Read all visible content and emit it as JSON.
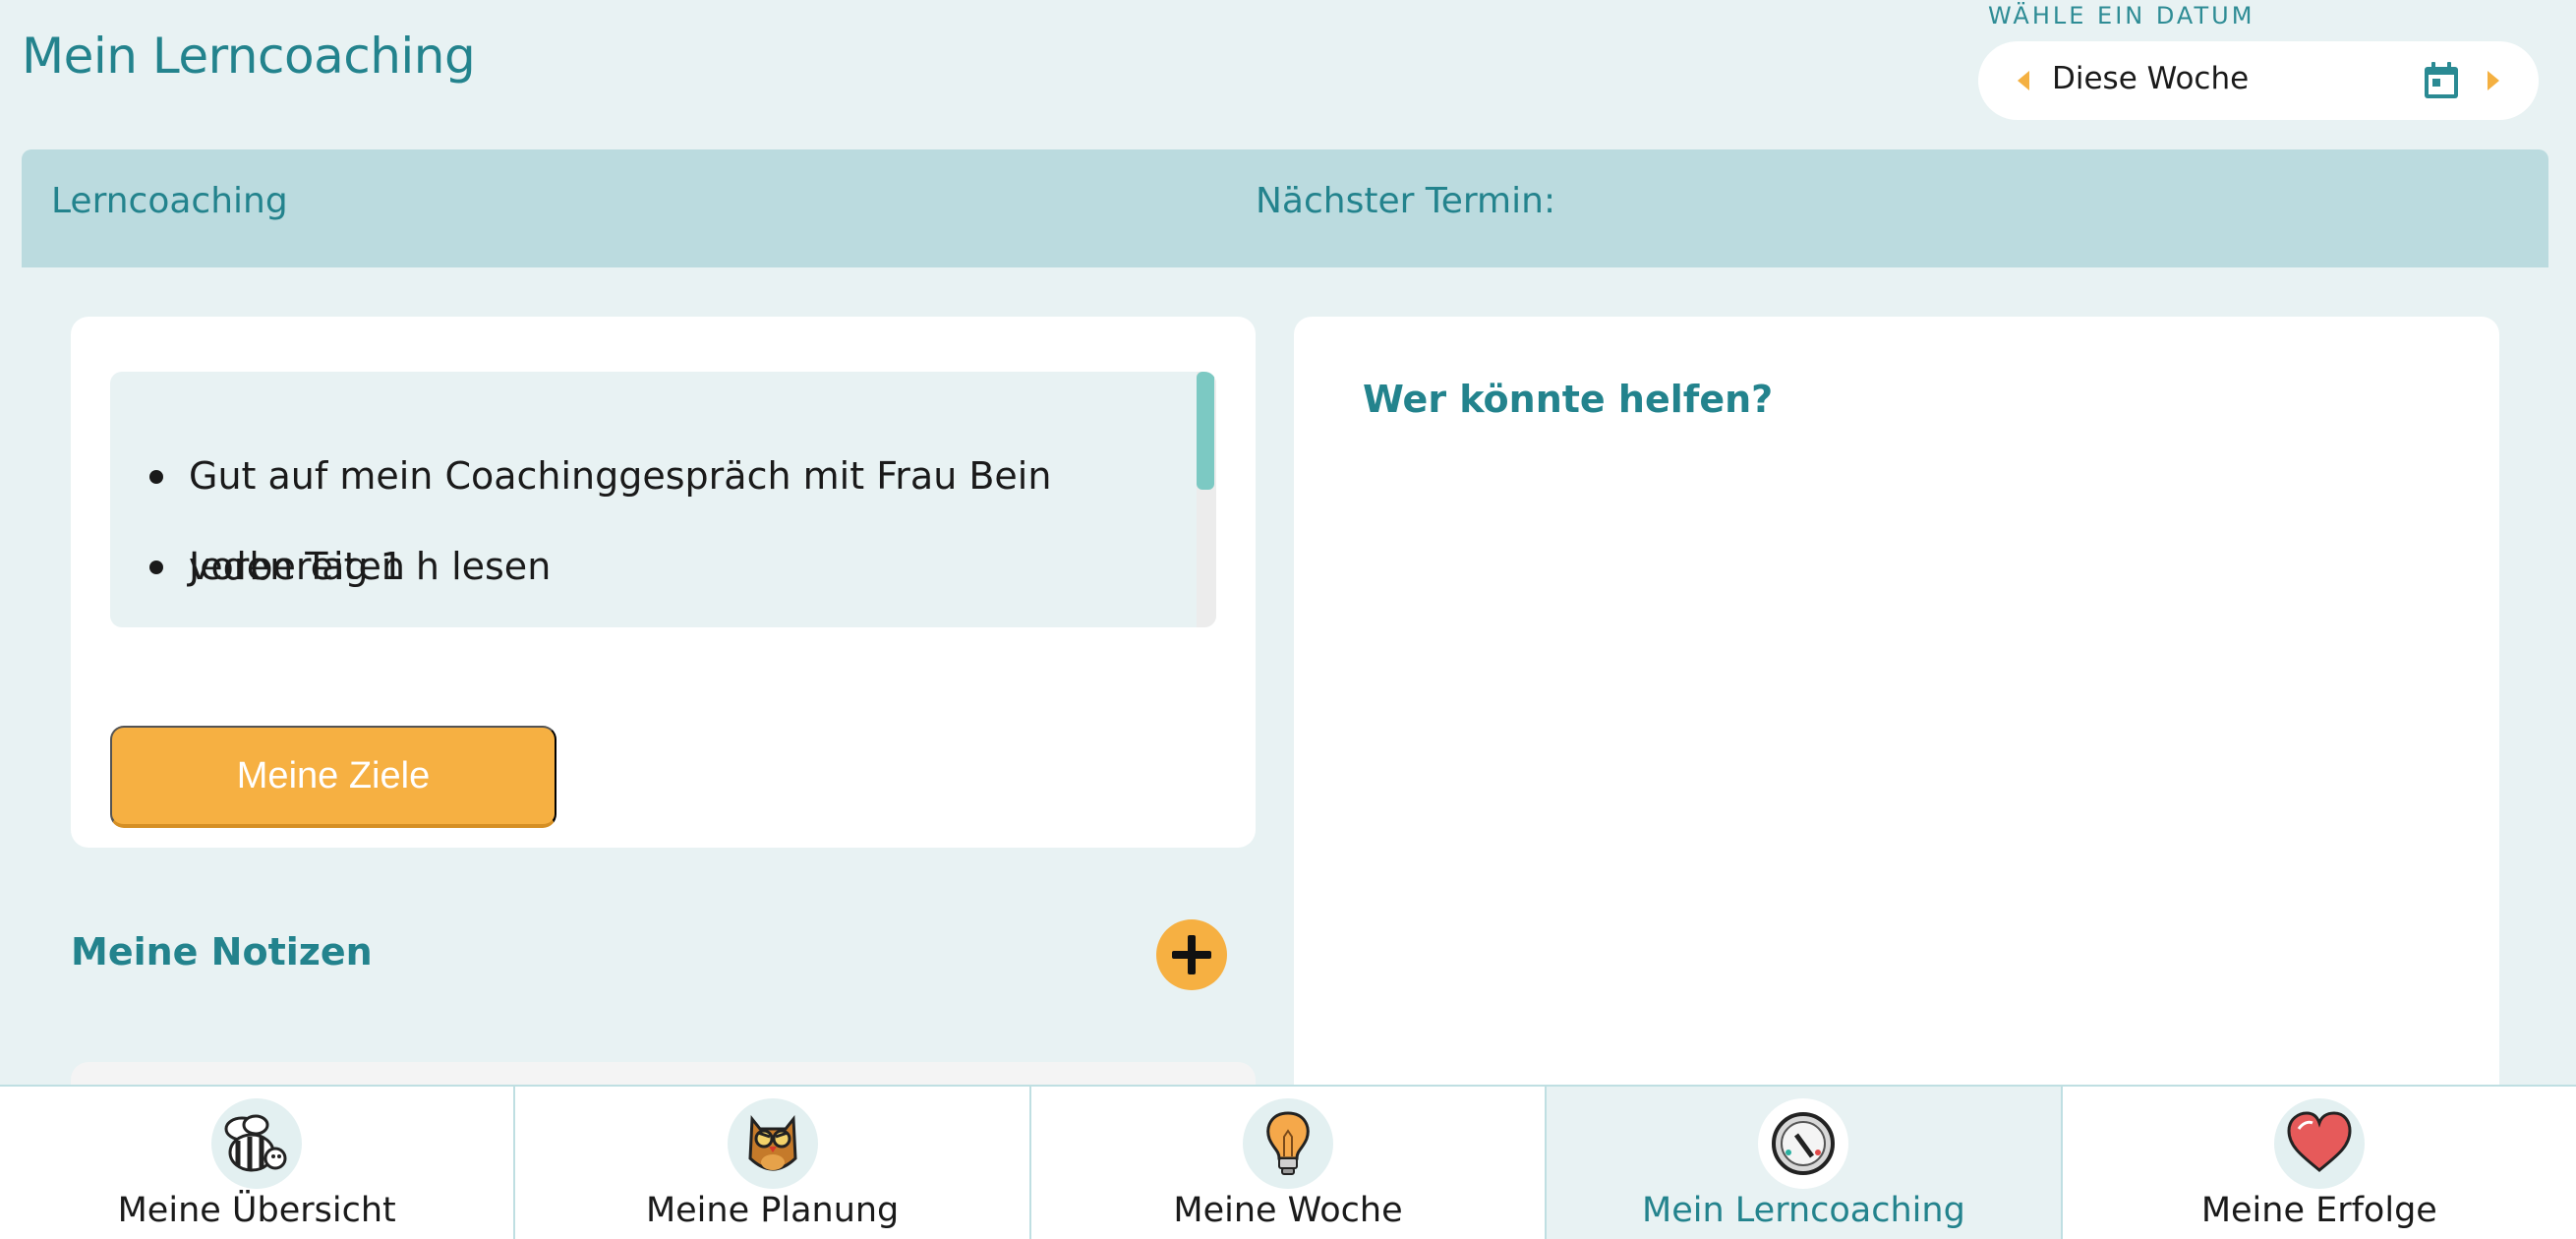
{
  "header": {
    "title": "Mein Lerncoaching",
    "date_caption": "WÄHLE EIN DATUM",
    "date_value": "Diese Woche"
  },
  "banner": {
    "left_label": "Lerncoaching",
    "right_label": "Nächster Termin:"
  },
  "goals": {
    "items": [
      "Gut auf mein Coachinggespräch mit Frau Bein vorbereiten",
      "Jeden Tag 1 h lesen"
    ],
    "button_label": "Meine Ziele"
  },
  "notes": {
    "title": "Meine Notizen"
  },
  "help": {
    "title": "Wer könnte helfen?"
  },
  "nav": {
    "items": [
      {
        "label": "Meine Übersicht",
        "icon": "bee-icon",
        "active": false
      },
      {
        "label": "Meine Planung",
        "icon": "owl-icon",
        "active": false
      },
      {
        "label": "Meine Woche",
        "icon": "lightbulb-icon",
        "active": false
      },
      {
        "label": "Mein Lerncoaching",
        "icon": "compass-icon",
        "active": true
      },
      {
        "label": "Meine Erfolge",
        "icon": "heart-icon",
        "active": false
      }
    ]
  },
  "colors": {
    "accent": "#23838d",
    "button": "#f6b042",
    "background": "#e8f2f3",
    "banner": "#bbdbdf"
  }
}
